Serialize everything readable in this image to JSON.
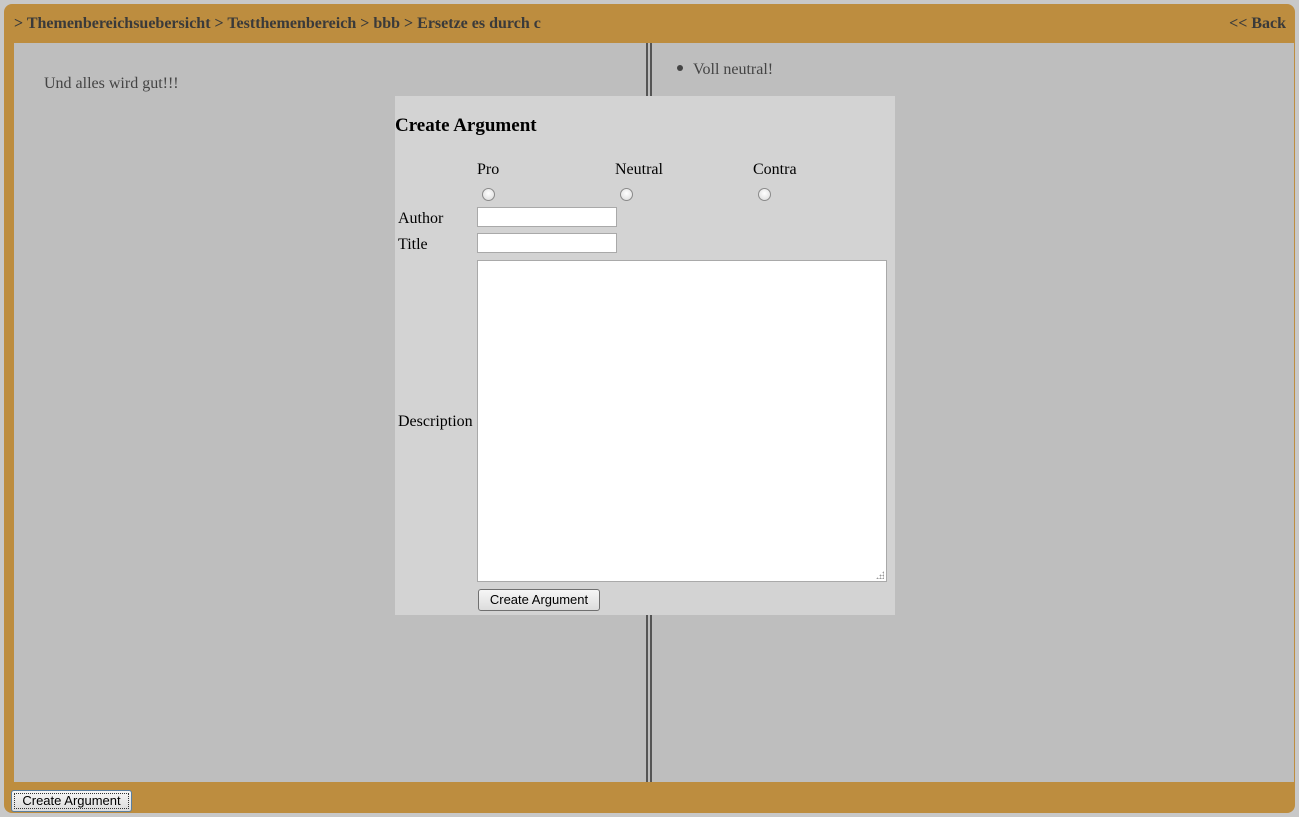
{
  "header": {
    "breadcrumb": "> Themenbereichsuebersicht > Testthemenbereich > bbb > Ersetze es durch c",
    "back_label": "<< Back"
  },
  "left_panel": {
    "text": "Und alles wird gut!!!"
  },
  "right_panel": {
    "items": [
      "Voll neutral!"
    ]
  },
  "dialog": {
    "title": "Create Argument",
    "stances": [
      "Pro",
      "Neutral",
      "Contra"
    ],
    "author_label": "Author",
    "author_value": "",
    "title_label": "Title",
    "title_value": "",
    "description_label": "Description",
    "description_value": "",
    "submit_label": "Create Argument"
  },
  "footer": {
    "create_button_label": "Create Argument"
  },
  "colors": {
    "frame": "#bd8d3f",
    "content_bg": "#bebebe",
    "dialog_bg": "#d3d3d3"
  }
}
